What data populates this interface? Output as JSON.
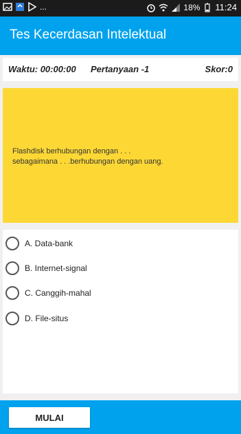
{
  "statusbar": {
    "left_icons": [
      "gallery-icon",
      "box-icon",
      "play-icon"
    ],
    "left_more": "...",
    "battery": "18%",
    "time": "11:24"
  },
  "app": {
    "title": "Tes Kecerdasan Intelektual"
  },
  "info": {
    "time_label": "Waktu: 00:00:00",
    "question_label": "Pertanyaan -1",
    "score_label": "Skor:0"
  },
  "question": {
    "line1": "Flashdisk berhubungan dengan . . .",
    "line2": "sebagaimana . . .berhubungan dengan uang."
  },
  "options": [
    {
      "label": "A. Data-bank"
    },
    {
      "label": "B. Internet-signal"
    },
    {
      "label": "C. Canggih-mahal"
    },
    {
      "label": "D. File-situs"
    }
  ],
  "bottom": {
    "start_label": "MULAI"
  },
  "colors": {
    "primary": "#00a2ee",
    "question_bg": "#fdd835",
    "statusbar": "#1b1b1b"
  }
}
